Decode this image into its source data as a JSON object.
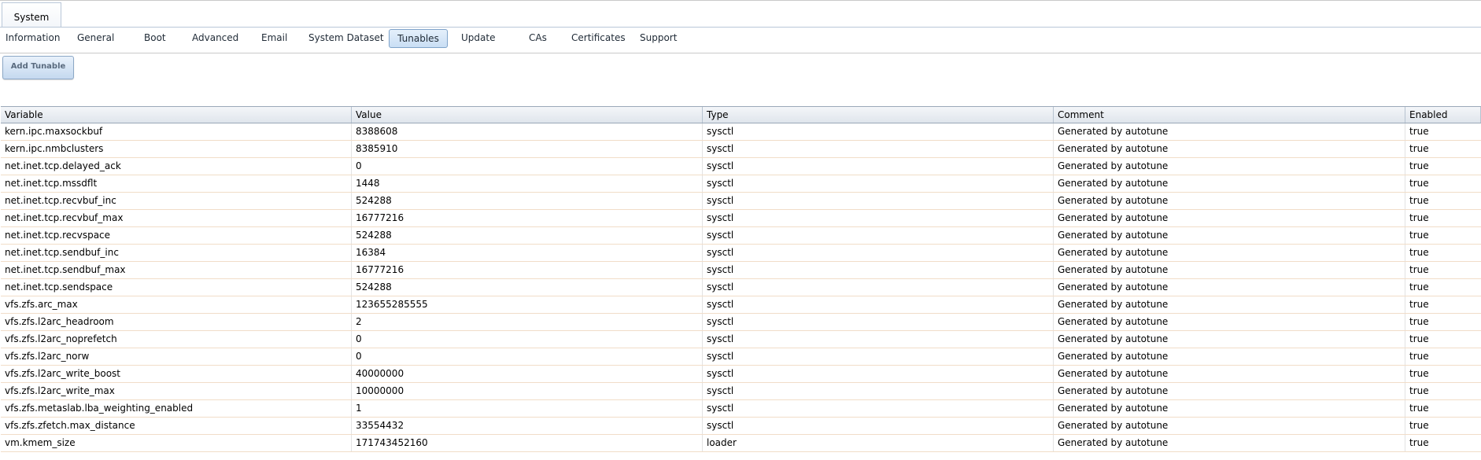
{
  "outer_tab": {
    "label": "System"
  },
  "subtabs": [
    {
      "label": "Information",
      "active": false
    },
    {
      "label": "General",
      "active": false
    },
    {
      "label": "Boot",
      "active": false
    },
    {
      "label": "Advanced",
      "active": false
    },
    {
      "label": "Email",
      "active": false
    },
    {
      "label": "System Dataset",
      "active": false
    },
    {
      "label": "Tunables",
      "active": true
    },
    {
      "label": "Update",
      "active": false
    },
    {
      "label": "CAs",
      "active": false
    },
    {
      "label": "Certificates",
      "active": false
    },
    {
      "label": "Support",
      "active": false
    }
  ],
  "toolbar": {
    "add_label": "Add Tunable"
  },
  "table": {
    "columns": [
      "Variable",
      "Value",
      "Type",
      "Comment",
      "Enabled"
    ],
    "rows": [
      [
        "kern.ipc.maxsockbuf",
        "8388608",
        "sysctl",
        "Generated by autotune",
        "true"
      ],
      [
        "kern.ipc.nmbclusters",
        "8385910",
        "sysctl",
        "Generated by autotune",
        "true"
      ],
      [
        "net.inet.tcp.delayed_ack",
        "0",
        "sysctl",
        "Generated by autotune",
        "true"
      ],
      [
        "net.inet.tcp.mssdflt",
        "1448",
        "sysctl",
        "Generated by autotune",
        "true"
      ],
      [
        "net.inet.tcp.recvbuf_inc",
        "524288",
        "sysctl",
        "Generated by autotune",
        "true"
      ],
      [
        "net.inet.tcp.recvbuf_max",
        "16777216",
        "sysctl",
        "Generated by autotune",
        "true"
      ],
      [
        "net.inet.tcp.recvspace",
        "524288",
        "sysctl",
        "Generated by autotune",
        "true"
      ],
      [
        "net.inet.tcp.sendbuf_inc",
        "16384",
        "sysctl",
        "Generated by autotune",
        "true"
      ],
      [
        "net.inet.tcp.sendbuf_max",
        "16777216",
        "sysctl",
        "Generated by autotune",
        "true"
      ],
      [
        "net.inet.tcp.sendspace",
        "524288",
        "sysctl",
        "Generated by autotune",
        "true"
      ],
      [
        "vfs.zfs.arc_max",
        "123655285555",
        "sysctl",
        "Generated by autotune",
        "true"
      ],
      [
        "vfs.zfs.l2arc_headroom",
        "2",
        "sysctl",
        "Generated by autotune",
        "true"
      ],
      [
        "vfs.zfs.l2arc_noprefetch",
        "0",
        "sysctl",
        "Generated by autotune",
        "true"
      ],
      [
        "vfs.zfs.l2arc_norw",
        "0",
        "sysctl",
        "Generated by autotune",
        "true"
      ],
      [
        "vfs.zfs.l2arc_write_boost",
        "40000000",
        "sysctl",
        "Generated by autotune",
        "true"
      ],
      [
        "vfs.zfs.l2arc_write_max",
        "10000000",
        "sysctl",
        "Generated by autotune",
        "true"
      ],
      [
        "vfs.zfs.metaslab.lba_weighting_enabled",
        "1",
        "sysctl",
        "Generated by autotune",
        "true"
      ],
      [
        "vfs.zfs.zfetch.max_distance",
        "33554432",
        "sysctl",
        "Generated by autotune",
        "true"
      ],
      [
        "vm.kmem_size",
        "171743452160",
        "loader",
        "Generated by autotune",
        "true"
      ]
    ]
  }
}
